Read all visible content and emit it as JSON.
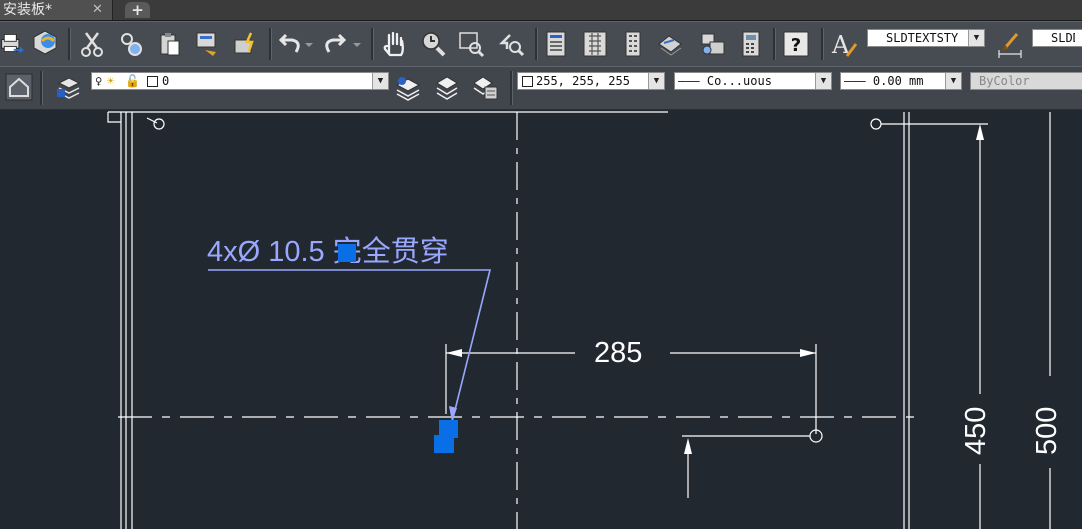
{
  "tabs": {
    "active_doc": "安装板*",
    "close_glyph": "✕",
    "new_tab_glyph": "+"
  },
  "toolbar1": {
    "buttons": [
      "plot-icon",
      "3d-preview-icon",
      "cut-icon",
      "copy-icon",
      "paste-icon",
      "match-properties-icon",
      "block-editor-icon",
      "undo-icon",
      "redo-icon",
      "pan-icon",
      "zoom-realtime-icon",
      "zoom-window-icon",
      "zoom-previous-icon",
      "properties-icon",
      "design-center-icon",
      "tool-palettes-icon",
      "sheet-set-icon",
      "markup-icon",
      "quickcalc-icon",
      "help-icon",
      "text-style-icon",
      "dim-style-icon"
    ],
    "text_style": "SLDTEXTSTY",
    "dim_style": "SLDD"
  },
  "toolbar2": {
    "layer_value": "0",
    "color_value": "255, 255, 255",
    "linetype_value": "——— Co...uous",
    "lineweight_value": "——— 0.00 mm",
    "plotstyle_value": "ByColor"
  },
  "drawing": {
    "leader_note": "4xØ  10.5 完全贯穿",
    "dim_285": "285",
    "dim_450": "450",
    "dim_500": "500",
    "colors": {
      "background": "#212830",
      "lines": "#ffffff",
      "leader": "#9aa7ff",
      "grip": "#0a6fe6"
    }
  }
}
